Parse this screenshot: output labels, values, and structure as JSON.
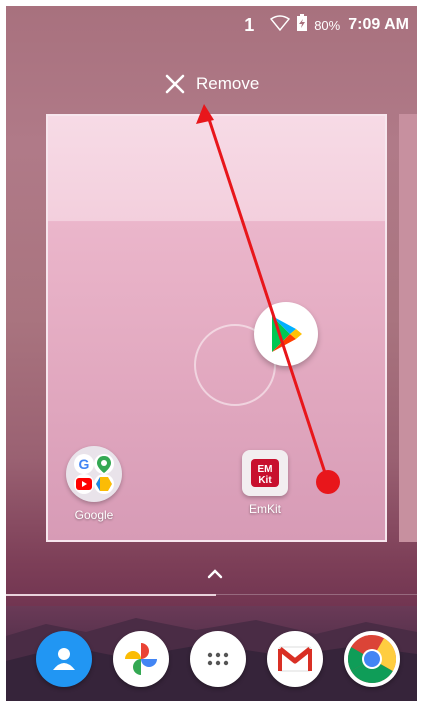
{
  "status_bar": {
    "sim": "1",
    "battery": "80%",
    "time": "7:09 AM",
    "icons": [
      "wifi-icon",
      "battery-charging-icon"
    ]
  },
  "drop_target": {
    "label": "Remove",
    "icon": "close-icon"
  },
  "workspace": {
    "apps": [
      {
        "label": "Google",
        "icon": "google-folder-icon"
      },
      {
        "label": "EmKit",
        "icon": "emkit-icon"
      }
    ],
    "dragged_app": {
      "icon": "play-store-icon"
    }
  },
  "all_apps_handle": {
    "icon": "chevron-up-icon"
  },
  "dock": {
    "apps": [
      {
        "icon": "contacts-icon",
        "color": "#2196F3"
      },
      {
        "icon": "photos-icon",
        "color": "#ffffff"
      },
      {
        "icon": "app-drawer-icon",
        "color": "#ffffff"
      },
      {
        "icon": "gmail-icon",
        "color": "#ffffff"
      },
      {
        "icon": "chrome-icon",
        "color": "#ffffff"
      }
    ]
  },
  "colors": {
    "annotation_arrow": "#e8161b"
  }
}
